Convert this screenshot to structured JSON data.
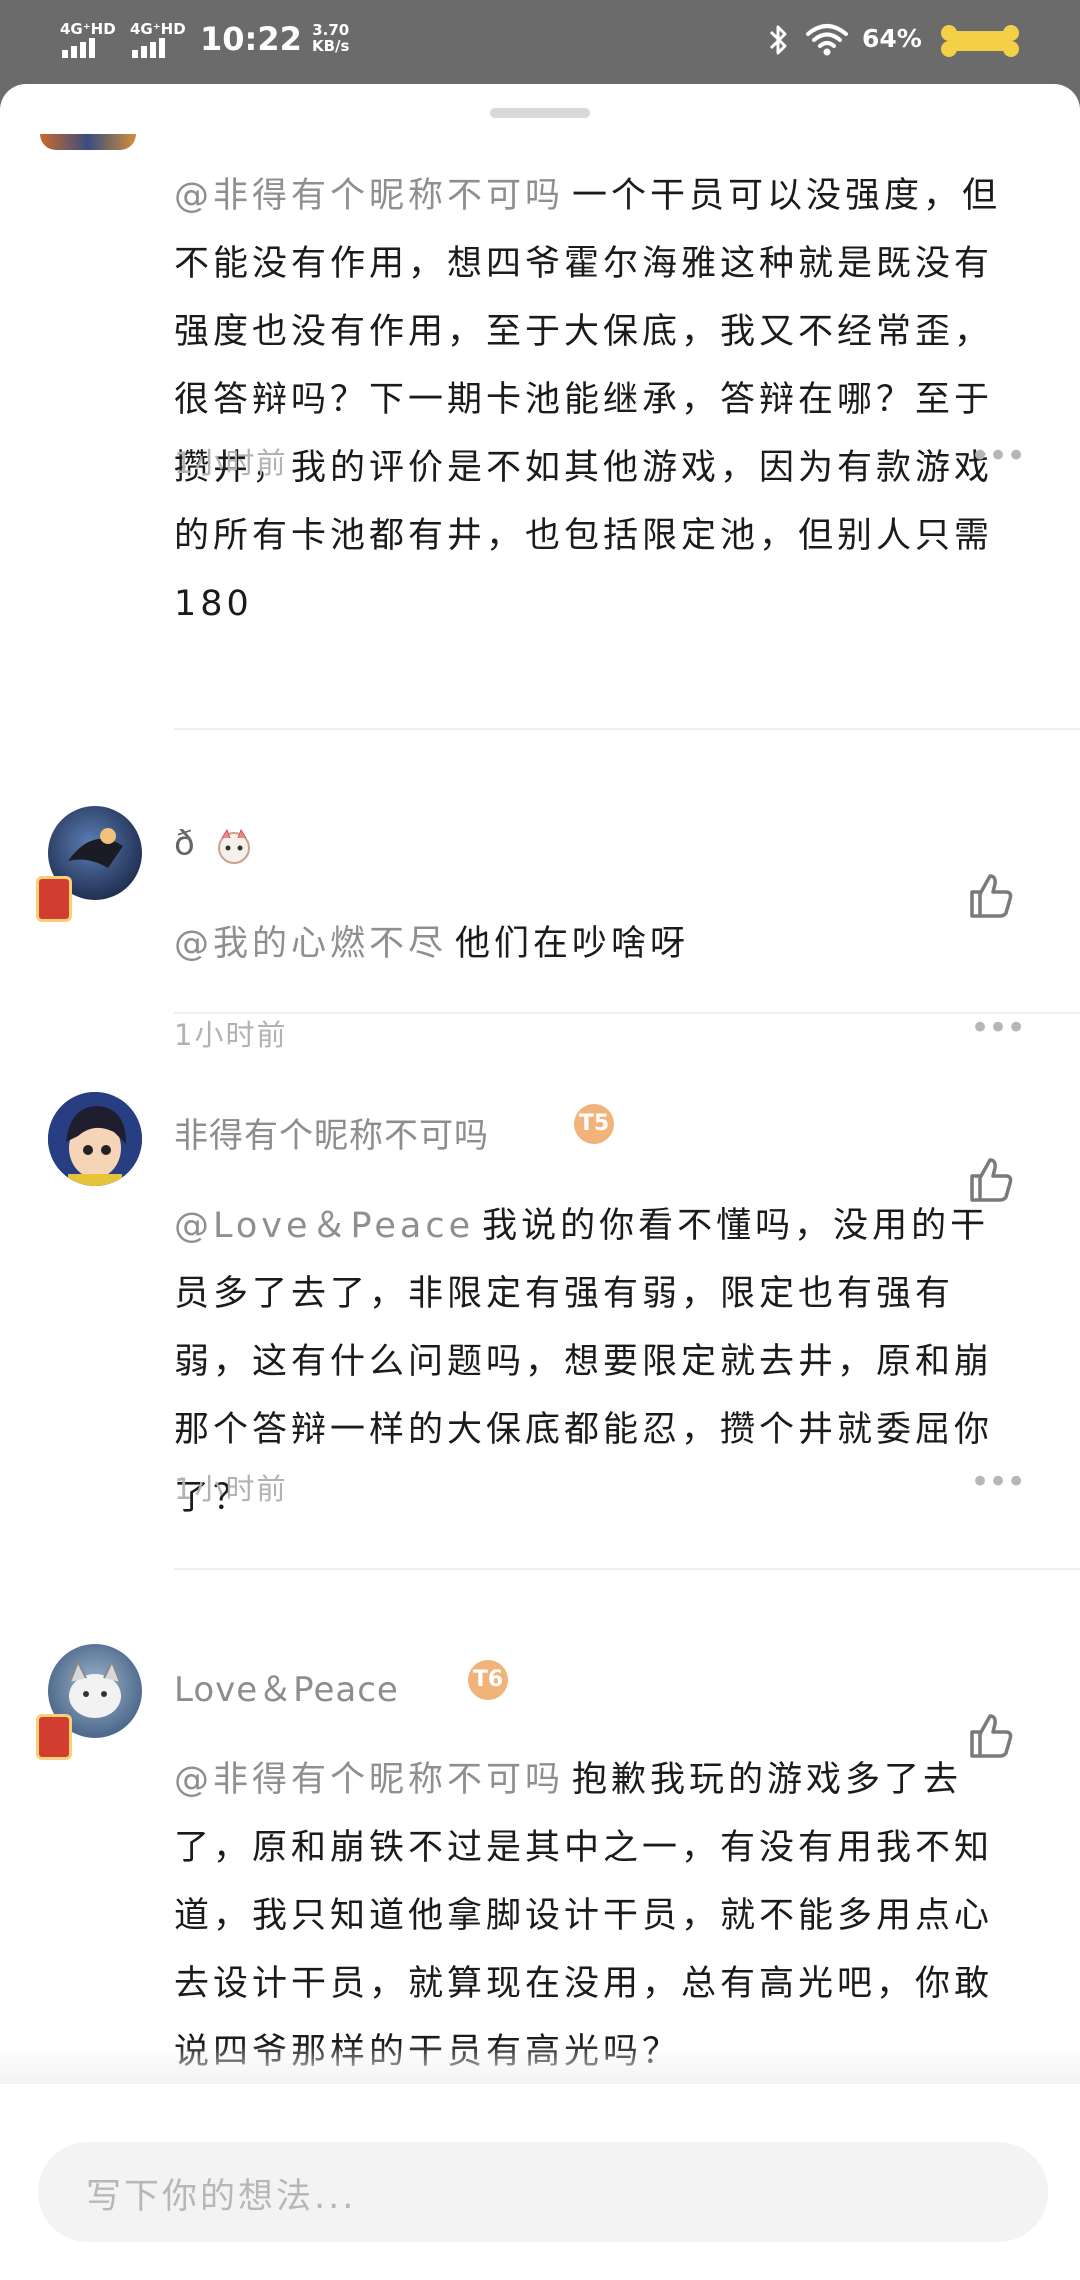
{
  "status_bar": {
    "sim1": "4G⁺HD",
    "sim2": "4G⁺HD",
    "time": "10:22",
    "speed_value": "3.70",
    "speed_unit": "KB/s",
    "battery": "64%"
  },
  "comments": [
    {
      "mention": "@非得有个昵称不可吗",
      "text": "一个干员可以没强度，但不能没有作用，想四爷霍尔海雅这种就是既没有强度也没有作用，至于大保底，我又不经常歪，很答辩吗？下一期卡池能继承，答辩在哪？至于攒井，我的评价是不如其他游戏，因为有款游戏的所有卡池都有井，也包括限定池，但别人只需180",
      "time": "1小时前"
    },
    {
      "name": "ð",
      "mention": "@我的心燃不尽",
      "text": "他们在吵啥呀",
      "time": "1小时前"
    },
    {
      "name": "非得有个昵称不可吗",
      "badge": "T5",
      "mention": "@Love＆Peace",
      "text": "我说的你看不懂吗，没用的干员多了去了，非限定有强有弱，限定也有强有弱，这有什么问题吗，想要限定就去井，原和崩那个答辩一样的大保底都能忍，攒个井就委屈你了？",
      "time": "1小时前"
    },
    {
      "name": "Love＆Peace",
      "badge": "T6",
      "mention": "@非得有个昵称不可吗",
      "text": "抱歉我玩的游戏多了去了，原和崩铁不过是其中之一，有没有用我不知道，我只知道他拿脚设计干员，就不能多用点心去设计干员，就算现在没用，总有高光吧，你敢说四爷那样的干员有高光吗？"
    }
  ],
  "input": {
    "placeholder": "写下你的想法..."
  },
  "icons": {
    "more": "more-dots-icon",
    "like": "thumbs-up-icon"
  }
}
